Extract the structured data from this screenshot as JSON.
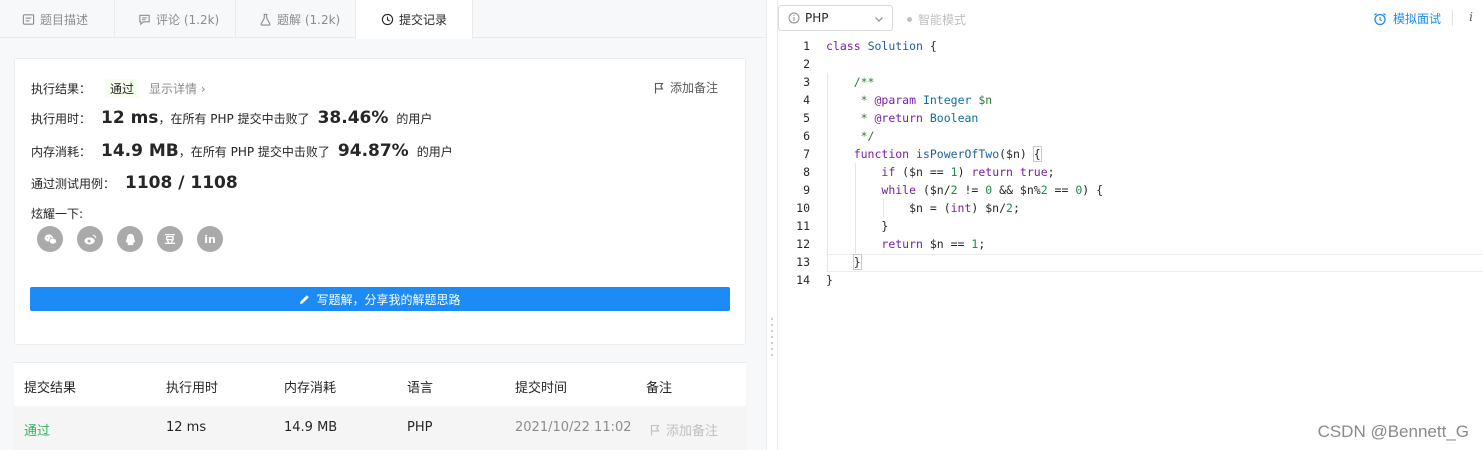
{
  "tabs": [
    {
      "label": "题目描述",
      "icon": "description-icon"
    },
    {
      "label": "评论 (1.2k)",
      "icon": "comment-icon"
    },
    {
      "label": "题解 (1.2k)",
      "icon": "flask-icon"
    },
    {
      "label": "提交记录",
      "icon": "clock-icon"
    }
  ],
  "result": {
    "status_label": "执行结果：",
    "status": "通过",
    "detail_link": "显示详情 ›",
    "add_note": "添加备注",
    "time_label": "执行用时：",
    "time_value": "12 ms",
    "time_mid": "，在所有 PHP 提交中击败了",
    "time_pct": "38.46%",
    "users_suffix": "的用户",
    "mem_label": "内存消耗：",
    "mem_value": "14.9 MB",
    "mem_mid": "，在所有 PHP 提交中击败了",
    "mem_pct": "94.87%",
    "cases_label": "通过测试用例：",
    "cases_value": "1108 / 1108",
    "share_label": "炫耀一下:",
    "share_icons": [
      "wechat-icon",
      "weibo-icon",
      "qq-icon",
      "douban-icon",
      "linkedin-icon"
    ],
    "douban_glyph": "豆",
    "linkedin_glyph": "in",
    "write_button": "写题解，分享我的解题思路"
  },
  "submissions": {
    "headers": [
      "提交结果",
      "执行用时",
      "内存消耗",
      "语言",
      "提交时间",
      "备注"
    ],
    "rows": [
      {
        "status": "通过",
        "time": "12 ms",
        "memory": "14.9 MB",
        "language": "PHP",
        "submitted": "2021/10/22 11:02",
        "note": "添加备注"
      }
    ]
  },
  "toolbar": {
    "language": "PHP",
    "smart_mode": "智能模式",
    "mock_interview": "模拟面试",
    "info": "i"
  },
  "editor": {
    "current_line": 13,
    "lines": [
      "class Solution {",
      "",
      "    /**",
      "     * @param Integer $n",
      "     * @return Boolean",
      "     */",
      "    function isPowerOfTwo($n) {",
      "        if ($n == 1) return true;",
      "        while ($n/2 != 0 && $n%2 == 0) {",
      "            $n = (int) $n/2;",
      "        }",
      "        return $n == 1;",
      "    }",
      "}"
    ]
  },
  "watermark": "CSDN @Bennett_G",
  "colors": {
    "accent": "#1c8bf5",
    "success": "#2db55d",
    "keyword": "#7a1fa2",
    "comment": "#2e7d32"
  }
}
